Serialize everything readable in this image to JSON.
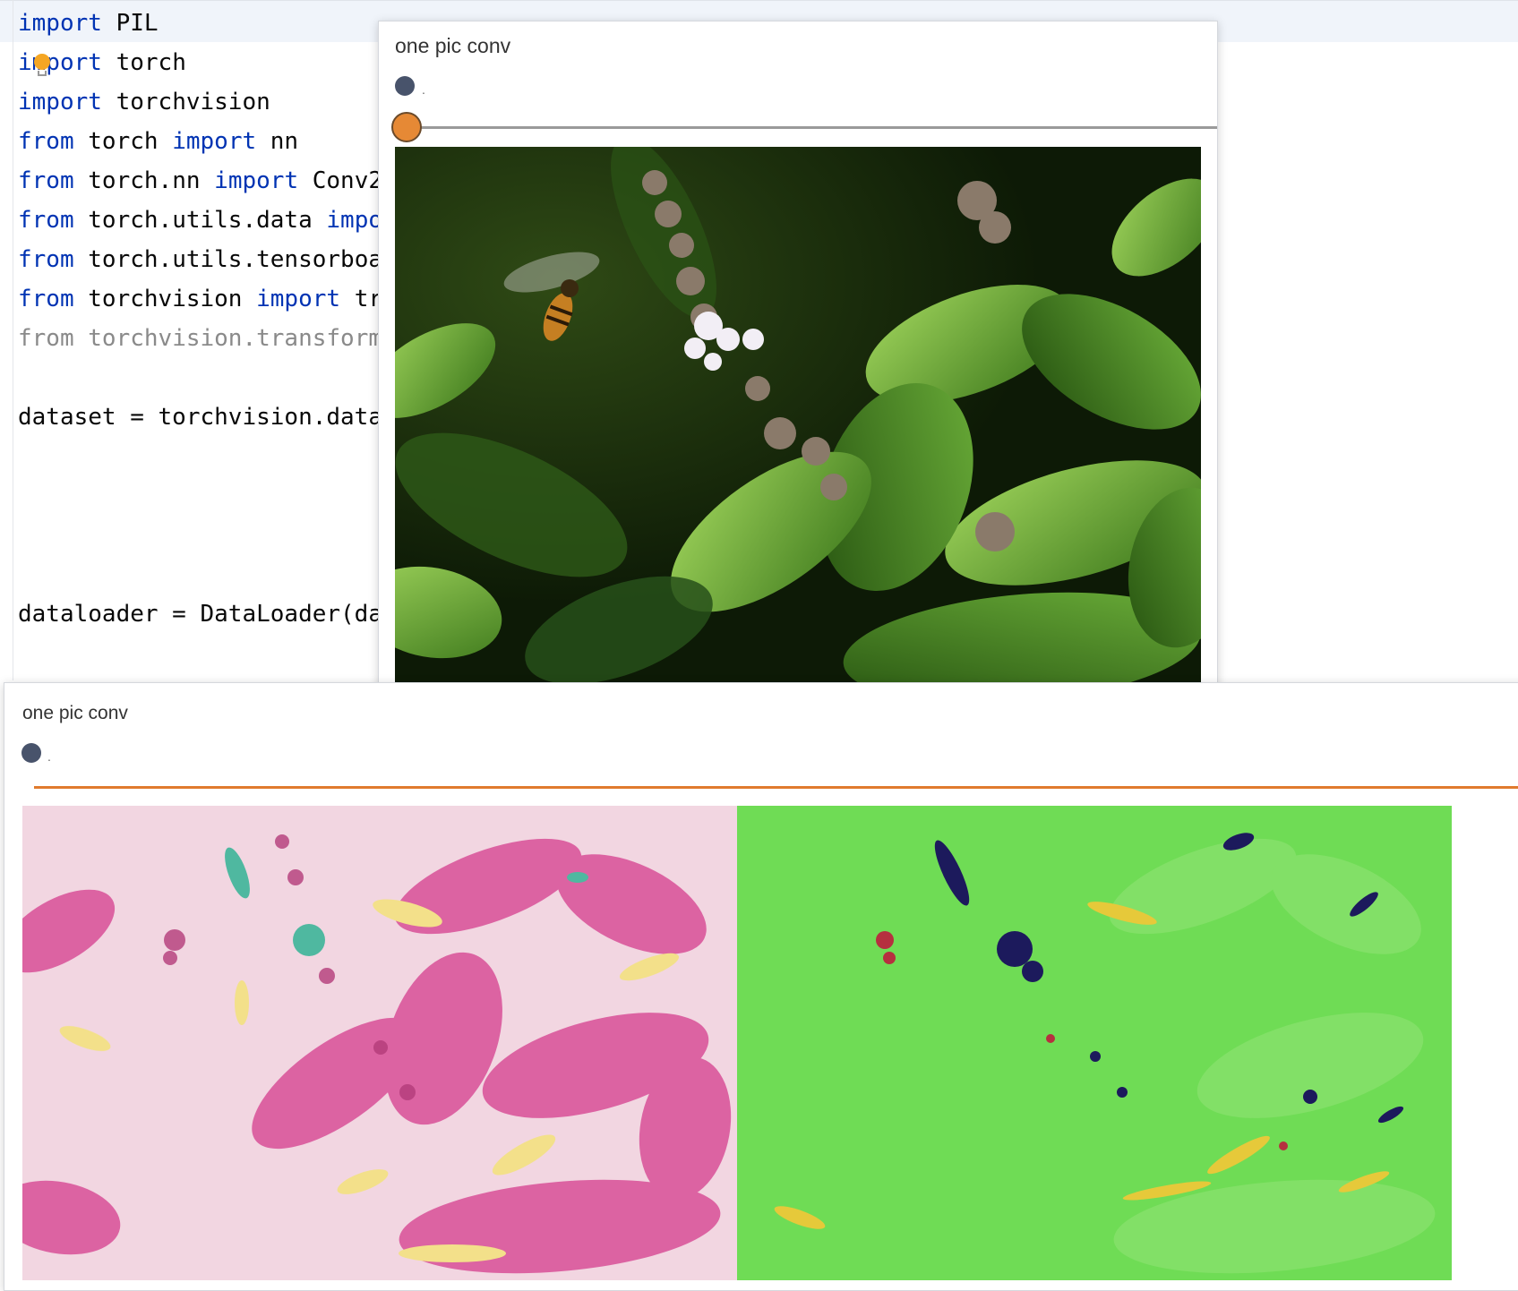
{
  "editor": {
    "lines": [
      {
        "kw1": "import",
        "t1": " PIL",
        "kw2": "",
        "t2": "",
        "dim": false
      },
      {
        "kw1": "import",
        "t1": " torch",
        "kw2": "",
        "t2": "",
        "dim": false
      },
      {
        "kw1": "import",
        "t1": " torchvision",
        "kw2": "",
        "t2": "",
        "dim": false
      },
      {
        "kw1": "from",
        "t1": " torch ",
        "kw2": "import",
        "t2": " nn",
        "dim": false
      },
      {
        "kw1": "from",
        "t1": " torch.nn ",
        "kw2": "import",
        "t2": " Conv2",
        "dim": false
      },
      {
        "kw1": "from",
        "t1": " torch.utils.data ",
        "kw2": "impo",
        "t2": "",
        "dim": false
      },
      {
        "kw1": "from",
        "t1": " torch.utils.tensorboa",
        "kw2": "",
        "t2": "",
        "dim": false
      },
      {
        "kw1": "from",
        "t1": " torchvision ",
        "kw2": "import",
        "t2": " tr",
        "dim": false
      },
      {
        "kw1": "from",
        "t1": " torchvision.transform",
        "kw2": "",
        "t2": "",
        "dim": true
      },
      {
        "kw1": "",
        "t1": "",
        "kw2": "",
        "t2": "",
        "dim": false
      },
      {
        "kw1": "",
        "t1": "dataset = torchvision.data",
        "kw2": "",
        "t2": "",
        "dim": false
      },
      {
        "kw1": "",
        "t1": "",
        "kw2": "",
        "t2": "",
        "dim": false
      },
      {
        "kw1": "",
        "t1": "",
        "kw2": "",
        "t2": "",
        "dim": false
      },
      {
        "kw1": "",
        "t1": "",
        "kw2": "",
        "t2": "",
        "dim": false
      },
      {
        "kw1": "",
        "t1": "",
        "kw2": "",
        "t2": "",
        "dim": false
      },
      {
        "kw1": "",
        "t1": "dataloader = DataLoader(da",
        "kw2": "",
        "t2": "",
        "dim": false
      }
    ]
  },
  "top_window": {
    "title": "one pic conv",
    "dot_label": ".",
    "slider_value": 0
  },
  "bottom_window": {
    "title": "one pic conv",
    "dot_label": "."
  },
  "colors": {
    "keyword": "#0033b3",
    "slider": "#e68935",
    "dot": "#48536b",
    "divider": "#e07b2e"
  }
}
